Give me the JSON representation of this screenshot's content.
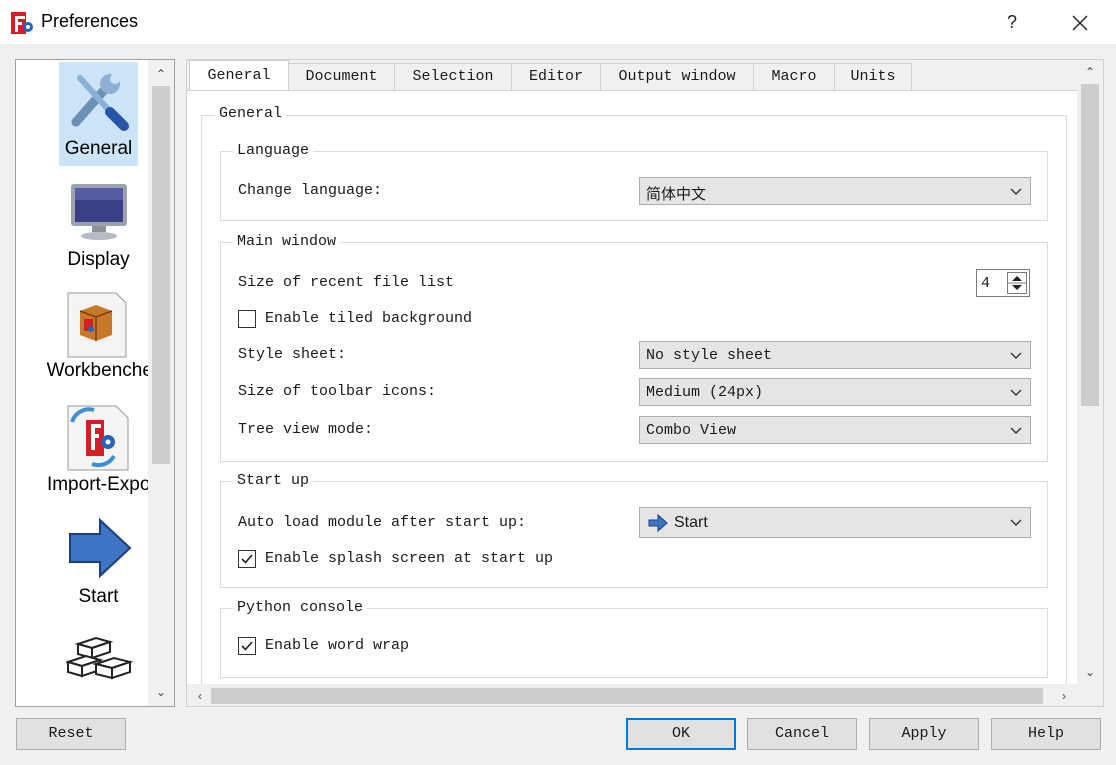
{
  "window": {
    "title": "Preferences",
    "help_label": "?"
  },
  "sidebar": {
    "items": [
      {
        "label": "General",
        "icon": "wrench-screwdriver-icon",
        "selected": true
      },
      {
        "label": "Display",
        "icon": "monitor-icon"
      },
      {
        "label": "Workbenches",
        "icon": "workbench-box-icon"
      },
      {
        "label": "Import-Export",
        "icon": "import-export-icon"
      },
      {
        "label": "Start",
        "icon": "right-arrow-icon"
      },
      {
        "label": "",
        "icon": "bricks-icon"
      }
    ]
  },
  "tabs": [
    {
      "label": "General",
      "active": true
    },
    {
      "label": "Document"
    },
    {
      "label": "Selection"
    },
    {
      "label": "Editor"
    },
    {
      "label": "Output window"
    },
    {
      "label": "Macro"
    },
    {
      "label": "Units"
    }
  ],
  "page": {
    "title": "General",
    "language": {
      "title": "Language",
      "change_language_label": "Change language:",
      "change_language_value": "简体中文"
    },
    "main_window": {
      "title": "Main window",
      "recent_files_label": "Size of recent file list",
      "recent_files_value": "4",
      "tiled_background_label": "Enable tiled background",
      "tiled_background_checked": false,
      "style_sheet_label": "Style sheet:",
      "style_sheet_value": "No style sheet",
      "toolbar_icons_label": "Size of toolbar icons:",
      "toolbar_icons_value": "Medium (24px)",
      "tree_view_label": "Tree view mode:",
      "tree_view_value": "Combo View"
    },
    "start_up": {
      "title": "Start up",
      "auto_load_label": "Auto load module after start up:",
      "auto_load_value": "Start",
      "splash_label": "Enable splash screen at start up",
      "splash_checked": true
    },
    "python_console": {
      "title": "Python console",
      "word_wrap_label": "Enable word wrap",
      "word_wrap_checked": true
    }
  },
  "buttons": {
    "reset": "Reset",
    "ok": "OK",
    "cancel": "Cancel",
    "apply": "Apply",
    "help": "Help"
  },
  "colors": {
    "accent": "#0078d7",
    "selection": "#cce4f7"
  }
}
